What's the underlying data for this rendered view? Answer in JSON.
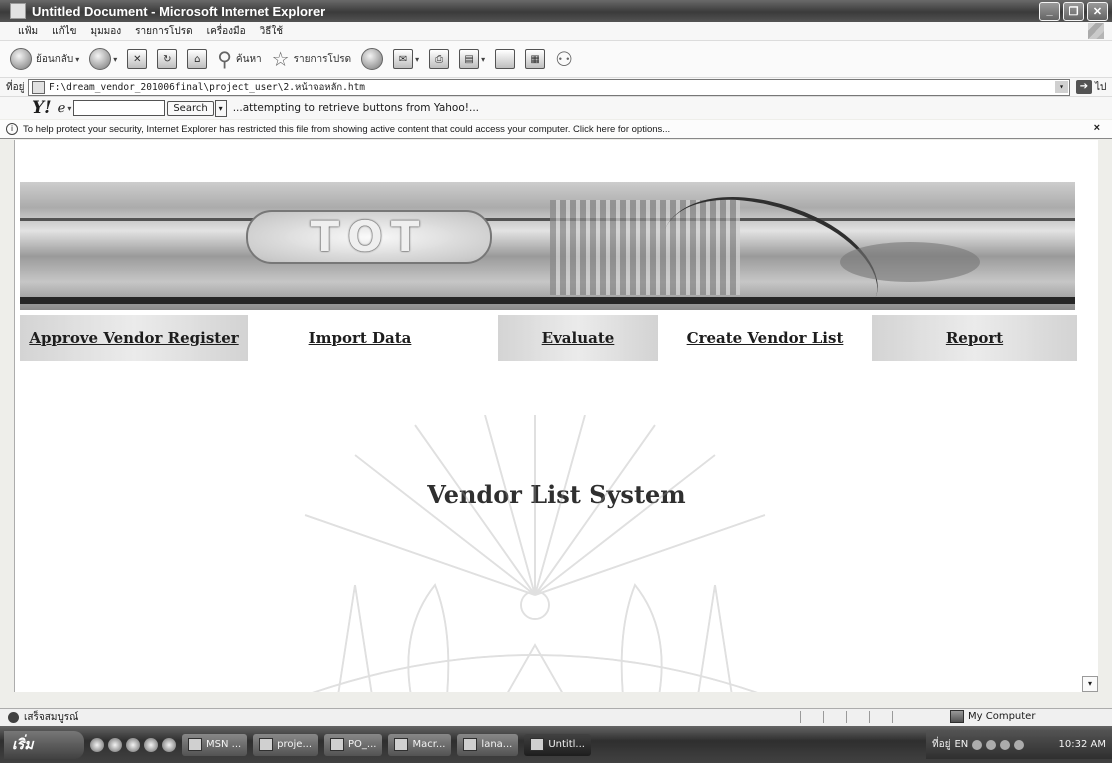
{
  "window": {
    "title": "Untitled Document - Microsoft Internet Explorer",
    "minimize": "_",
    "maximize": "❐",
    "close": "✕"
  },
  "menu": [
    "แฟ้ม",
    "แก้ไข",
    "มุมมอง",
    "รายการโปรด",
    "เครื่องมือ",
    "วิธีใช้"
  ],
  "toolbar": {
    "back_label": "ย้อนกลับ",
    "search_label": "ค้นหา",
    "favorites_label": "รายการโปรด"
  },
  "address": {
    "label": "ที่อยู่",
    "url": "F:\\dream_vendor_201006final\\project_user\\2.หน้าจอหลัก.htm",
    "go_label": "ไป"
  },
  "yahoo": {
    "logo": "Y!",
    "search_label": "Search",
    "input_value": "",
    "message": "...attempting to retrieve buttons from Yahoo!..."
  },
  "infobar": {
    "message": "To help protect your security, Internet Explorer has restricted this file from showing active content that could access your computer. Click here for options...",
    "close": "×"
  },
  "banner": {
    "logo_text": "TOT"
  },
  "nav": [
    {
      "label": "Approve Vendor Register"
    },
    {
      "label": "Import Data"
    },
    {
      "label": "Evaluate"
    },
    {
      "label": "Create Vendor List"
    },
    {
      "label": "Report"
    }
  ],
  "main": {
    "heading": "Vendor List System"
  },
  "statusbar": {
    "text": "เสร็จสมบูรณ์",
    "zone": "My Computer"
  },
  "taskbar": {
    "start_label": "เริ่ม",
    "tasks": [
      "MSN ...",
      "proje...",
      "PO_...",
      "Macr...",
      "lana...",
      "Untitl..."
    ],
    "tray_label": "ที่อยู่",
    "lang": "EN",
    "clock": "10:32 AM"
  },
  "colors": {
    "titlebar": "#4a4a4a",
    "content_bg": "#ffffff",
    "nav_text": "#222222"
  }
}
